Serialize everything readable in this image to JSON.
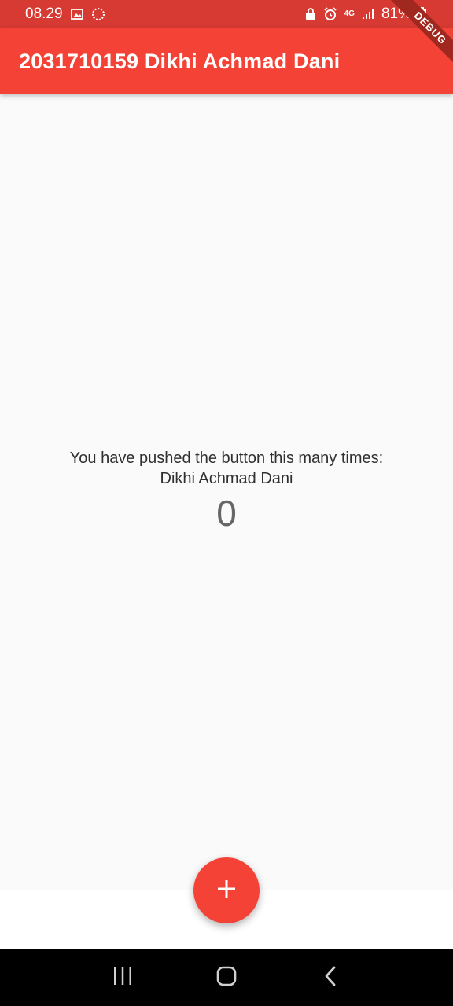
{
  "status_bar": {
    "time": "08.29",
    "battery_percent": "81%",
    "network": "4G",
    "icons": [
      "image-icon",
      "loading-icon",
      "lock-icon",
      "alarm-icon",
      "network-4g-icon",
      "signal-icon",
      "battery-charging-icon"
    ]
  },
  "app_bar": {
    "title": "2031710159 Dikhi Achmad Dani",
    "color": "#f44336"
  },
  "debug_banner": {
    "label": "DEBUG"
  },
  "content": {
    "counter_text": "You have pushed the button this many times:",
    "name_text": "Dikhi Achmad Dani",
    "count": "0"
  },
  "fab": {
    "icon": "add-icon",
    "color": "#f44336"
  },
  "nav_bar": {
    "buttons": [
      "recent-apps-icon",
      "home-icon",
      "back-icon"
    ]
  }
}
